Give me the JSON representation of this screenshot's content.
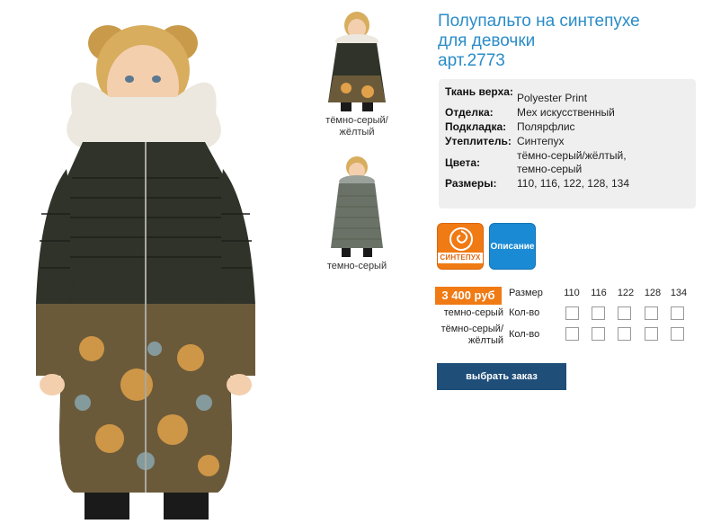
{
  "product": {
    "title_line1": "Полупальто на синтепухе",
    "title_line2": "для девочки",
    "article": "арт.2773"
  },
  "specs": [
    {
      "key": "Ткань верха:",
      "value": "Polyester Print"
    },
    {
      "key": "Отделка:",
      "value": "Мех искусственный"
    },
    {
      "key": "Подкладка:",
      "value": "Полярфлис"
    },
    {
      "key": "Утеплитель:",
      "value": "Синтепух"
    },
    {
      "key": "Цвета:",
      "value": "тёмно-серый/жёлтый, темно-серый"
    },
    {
      "key": "Размеры:",
      "value": "110, 116, 122, 128, 134"
    }
  ],
  "thumbnails": [
    {
      "caption": "тёмно-серый/жёлтый",
      "icon": "coat-print-photo"
    },
    {
      "caption": "темно-серый",
      "icon": "coat-plain-photo"
    }
  ],
  "features": {
    "sintepuh_label": "СИНТЕПУХ",
    "description_label": "Описание"
  },
  "order": {
    "price": "3 400 руб",
    "size_header": "Размер",
    "sizes": [
      "110",
      "116",
      "122",
      "128",
      "134"
    ],
    "qty_label": "Кол-во",
    "rows": [
      {
        "color": "темно-серый"
      },
      {
        "color": "тёмно-серый/жёлтый"
      }
    ],
    "submit_label": "выбрать заказ"
  },
  "colors": {
    "title_blue": "#2a8cc8",
    "accent_orange": "#f07a14",
    "button_dark_blue": "#1f4e79",
    "description_blue": "#1a8ad4"
  }
}
